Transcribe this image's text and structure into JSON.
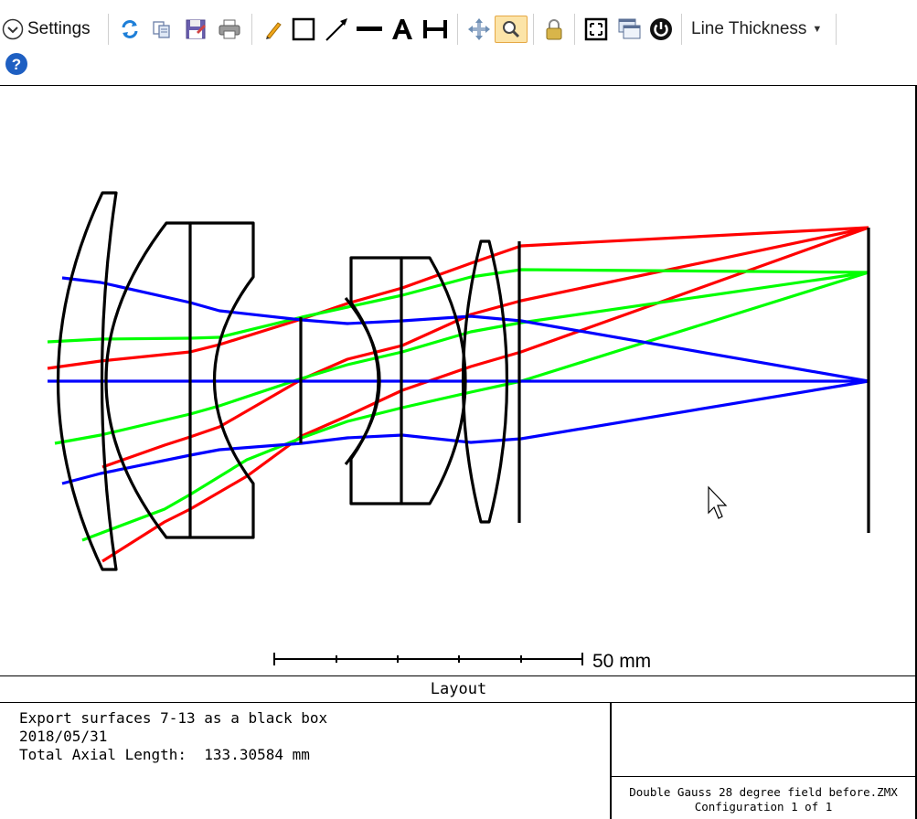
{
  "toolbar": {
    "settings_label": "Settings",
    "line_thickness_label": "Line Thickness",
    "buttons": [
      {
        "name": "collapse-icon"
      },
      {
        "name": "refresh-icon"
      },
      {
        "name": "copy-icon"
      },
      {
        "name": "save-icon"
      },
      {
        "name": "print-icon"
      },
      {
        "name": "pencil-icon"
      },
      {
        "name": "rectangle-icon"
      },
      {
        "name": "arrow-icon"
      },
      {
        "name": "line-icon"
      },
      {
        "name": "text-icon"
      },
      {
        "name": "dimension-icon"
      },
      {
        "name": "pan-icon"
      },
      {
        "name": "zoom-icon",
        "active": true
      },
      {
        "name": "lock-icon"
      },
      {
        "name": "fit-window-icon"
      },
      {
        "name": "new-window-icon"
      },
      {
        "name": "power-icon"
      },
      {
        "name": "help-icon"
      }
    ]
  },
  "plot": {
    "scale_label": "50 mm",
    "colors": {
      "field1": "#0000ff",
      "field2": "#00ff00",
      "field3": "#ff0000",
      "lens": "#000000"
    }
  },
  "title": "Layout",
  "info": {
    "line1": "Export surfaces 7-13 as a black box",
    "line2": "2018/05/31",
    "line3": "Total Axial Length:  133.30584 mm",
    "file": "Double Gauss 28 degree field before.ZMX",
    "config": "Configuration 1 of 1"
  }
}
